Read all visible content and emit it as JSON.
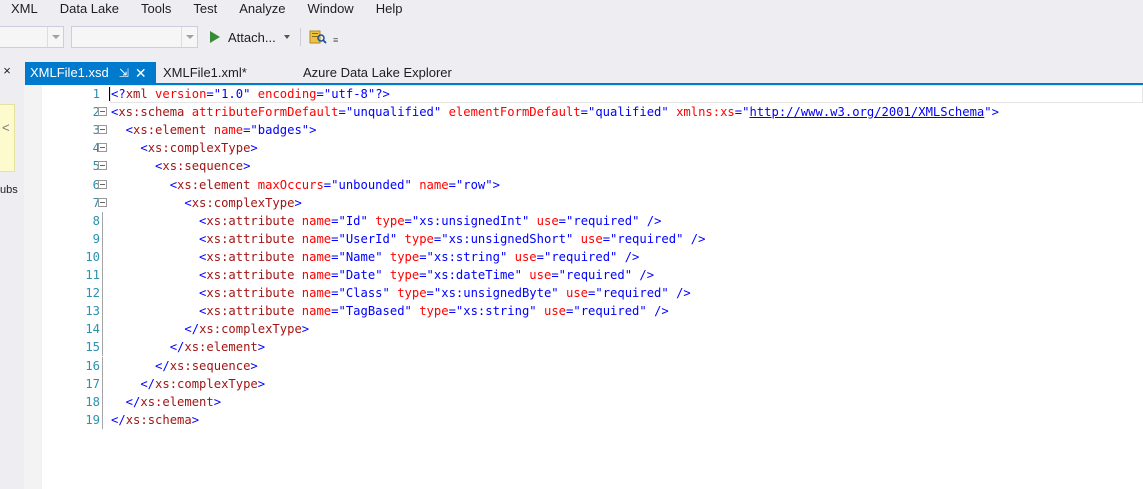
{
  "menu": [
    "XML",
    "Data Lake",
    "Tools",
    "Test",
    "Analyze",
    "Window",
    "Help"
  ],
  "toolbar": {
    "attach_label": "Attach...",
    "overflow_glyph": "≡"
  },
  "left_strip": {
    "close_glyph": "×",
    "chevron_glyph": "<",
    "text": "ubs"
  },
  "tabs": {
    "active": {
      "label": "XMLFile1.xsd",
      "pin_glyph": "⇲",
      "close_glyph": "✕"
    },
    "xml": {
      "label": "XMLFile1.xml*"
    },
    "azure": {
      "label": "Azure Data Lake Explorer"
    }
  },
  "editor": {
    "lines": [
      {
        "n": "1",
        "tokens": [
          [
            "b",
            "<?"
          ],
          [
            "tag",
            "xml"
          ],
          [
            "attr",
            " version"
          ],
          [
            "b",
            "=\""
          ],
          [
            "val",
            "1.0"
          ],
          [
            "b",
            "\""
          ],
          [
            "attr",
            " encoding"
          ],
          [
            "b",
            "=\""
          ],
          [
            "val",
            "utf-8"
          ],
          [
            "b",
            "\"?>"
          ]
        ]
      },
      {
        "n": "2",
        "tokens": [
          [
            "b",
            "<"
          ],
          [
            "tag",
            "xs:schema"
          ],
          [
            "attr",
            " attributeFormDefault"
          ],
          [
            "b",
            "=\""
          ],
          [
            "val",
            "unqualified"
          ],
          [
            "b",
            "\""
          ],
          [
            "attr",
            " elementFormDefault"
          ],
          [
            "b",
            "=\""
          ],
          [
            "val",
            "qualified"
          ],
          [
            "b",
            "\""
          ],
          [
            "attr",
            " xmlns:xs"
          ],
          [
            "b",
            "=\""
          ],
          [
            "url",
            "http://www.w3.org/2001/XMLSchema"
          ],
          [
            "b",
            "\">"
          ]
        ]
      },
      {
        "n": "3",
        "tokens": [
          [
            "b",
            "  <"
          ],
          [
            "tag",
            "xs:element"
          ],
          [
            "attr",
            " name"
          ],
          [
            "b",
            "=\""
          ],
          [
            "val",
            "badges"
          ],
          [
            "b",
            "\">"
          ]
        ]
      },
      {
        "n": "4",
        "tokens": [
          [
            "b",
            "    <"
          ],
          [
            "tag",
            "xs:complexType"
          ],
          [
            "b",
            ">"
          ]
        ]
      },
      {
        "n": "5",
        "tokens": [
          [
            "b",
            "      <"
          ],
          [
            "tag",
            "xs:sequence"
          ],
          [
            "b",
            ">"
          ]
        ]
      },
      {
        "n": "6",
        "tokens": [
          [
            "b",
            "        <"
          ],
          [
            "tag",
            "xs:element"
          ],
          [
            "attr",
            " maxOccurs"
          ],
          [
            "b",
            "=\""
          ],
          [
            "val",
            "unbounded"
          ],
          [
            "b",
            "\""
          ],
          [
            "attr",
            " name"
          ],
          [
            "b",
            "=\""
          ],
          [
            "val",
            "row"
          ],
          [
            "b",
            "\">"
          ]
        ]
      },
      {
        "n": "7",
        "tokens": [
          [
            "b",
            "          <"
          ],
          [
            "tag",
            "xs:complexType"
          ],
          [
            "b",
            ">"
          ]
        ]
      },
      {
        "n": "8",
        "tokens": [
          [
            "b",
            "            <"
          ],
          [
            "tag",
            "xs:attribute"
          ],
          [
            "attr",
            " name"
          ],
          [
            "b",
            "=\""
          ],
          [
            "val",
            "Id"
          ],
          [
            "b",
            "\""
          ],
          [
            "attr",
            " type"
          ],
          [
            "b",
            "=\""
          ],
          [
            "val",
            "xs:unsignedInt"
          ],
          [
            "b",
            "\""
          ],
          [
            "attr",
            " use"
          ],
          [
            "b",
            "=\""
          ],
          [
            "val",
            "required"
          ],
          [
            "b",
            "\" />"
          ]
        ]
      },
      {
        "n": "9",
        "tokens": [
          [
            "b",
            "            <"
          ],
          [
            "tag",
            "xs:attribute"
          ],
          [
            "attr",
            " name"
          ],
          [
            "b",
            "=\""
          ],
          [
            "val",
            "UserId"
          ],
          [
            "b",
            "\""
          ],
          [
            "attr",
            " type"
          ],
          [
            "b",
            "=\""
          ],
          [
            "val",
            "xs:unsignedShort"
          ],
          [
            "b",
            "\""
          ],
          [
            "attr",
            " use"
          ],
          [
            "b",
            "=\""
          ],
          [
            "val",
            "required"
          ],
          [
            "b",
            "\" />"
          ]
        ]
      },
      {
        "n": "10",
        "tokens": [
          [
            "b",
            "            <"
          ],
          [
            "tag",
            "xs:attribute"
          ],
          [
            "attr",
            " name"
          ],
          [
            "b",
            "=\""
          ],
          [
            "val",
            "Name"
          ],
          [
            "b",
            "\""
          ],
          [
            "attr",
            " type"
          ],
          [
            "b",
            "=\""
          ],
          [
            "val",
            "xs:string"
          ],
          [
            "b",
            "\""
          ],
          [
            "attr",
            " use"
          ],
          [
            "b",
            "=\""
          ],
          [
            "val",
            "required"
          ],
          [
            "b",
            "\" />"
          ]
        ]
      },
      {
        "n": "11",
        "tokens": [
          [
            "b",
            "            <"
          ],
          [
            "tag",
            "xs:attribute"
          ],
          [
            "attr",
            " name"
          ],
          [
            "b",
            "=\""
          ],
          [
            "val",
            "Date"
          ],
          [
            "b",
            "\""
          ],
          [
            "attr",
            " type"
          ],
          [
            "b",
            "=\""
          ],
          [
            "val",
            "xs:dateTime"
          ],
          [
            "b",
            "\""
          ],
          [
            "attr",
            " use"
          ],
          [
            "b",
            "=\""
          ],
          [
            "val",
            "required"
          ],
          [
            "b",
            "\" />"
          ]
        ]
      },
      {
        "n": "12",
        "tokens": [
          [
            "b",
            "            <"
          ],
          [
            "tag",
            "xs:attribute"
          ],
          [
            "attr",
            " name"
          ],
          [
            "b",
            "=\""
          ],
          [
            "val",
            "Class"
          ],
          [
            "b",
            "\""
          ],
          [
            "attr",
            " type"
          ],
          [
            "b",
            "=\""
          ],
          [
            "val",
            "xs:unsignedByte"
          ],
          [
            "b",
            "\""
          ],
          [
            "attr",
            " use"
          ],
          [
            "b",
            "=\""
          ],
          [
            "val",
            "required"
          ],
          [
            "b",
            "\" />"
          ]
        ]
      },
      {
        "n": "13",
        "tokens": [
          [
            "b",
            "            <"
          ],
          [
            "tag",
            "xs:attribute"
          ],
          [
            "attr",
            " name"
          ],
          [
            "b",
            "=\""
          ],
          [
            "val",
            "TagBased"
          ],
          [
            "b",
            "\""
          ],
          [
            "attr",
            " type"
          ],
          [
            "b",
            "=\""
          ],
          [
            "val",
            "xs:string"
          ],
          [
            "b",
            "\""
          ],
          [
            "attr",
            " use"
          ],
          [
            "b",
            "=\""
          ],
          [
            "val",
            "required"
          ],
          [
            "b",
            "\" />"
          ]
        ]
      },
      {
        "n": "14",
        "tokens": [
          [
            "b",
            "          </"
          ],
          [
            "tag",
            "xs:complexType"
          ],
          [
            "b",
            ">"
          ]
        ]
      },
      {
        "n": "15",
        "tokens": [
          [
            "b",
            "        </"
          ],
          [
            "tag",
            "xs:element"
          ],
          [
            "b",
            ">"
          ]
        ]
      },
      {
        "n": "16",
        "tokens": [
          [
            "b",
            "      </"
          ],
          [
            "tag",
            "xs:sequence"
          ],
          [
            "b",
            ">"
          ]
        ]
      },
      {
        "n": "17",
        "tokens": [
          [
            "b",
            "    </"
          ],
          [
            "tag",
            "xs:complexType"
          ],
          [
            "b",
            ">"
          ]
        ]
      },
      {
        "n": "18",
        "tokens": [
          [
            "b",
            "  </"
          ],
          [
            "tag",
            "xs:element"
          ],
          [
            "b",
            ">"
          ]
        ]
      },
      {
        "n": "19",
        "tokens": [
          [
            "b",
            "</"
          ],
          [
            "tag",
            "xs:schema"
          ],
          [
            "b",
            ">"
          ]
        ]
      }
    ]
  }
}
